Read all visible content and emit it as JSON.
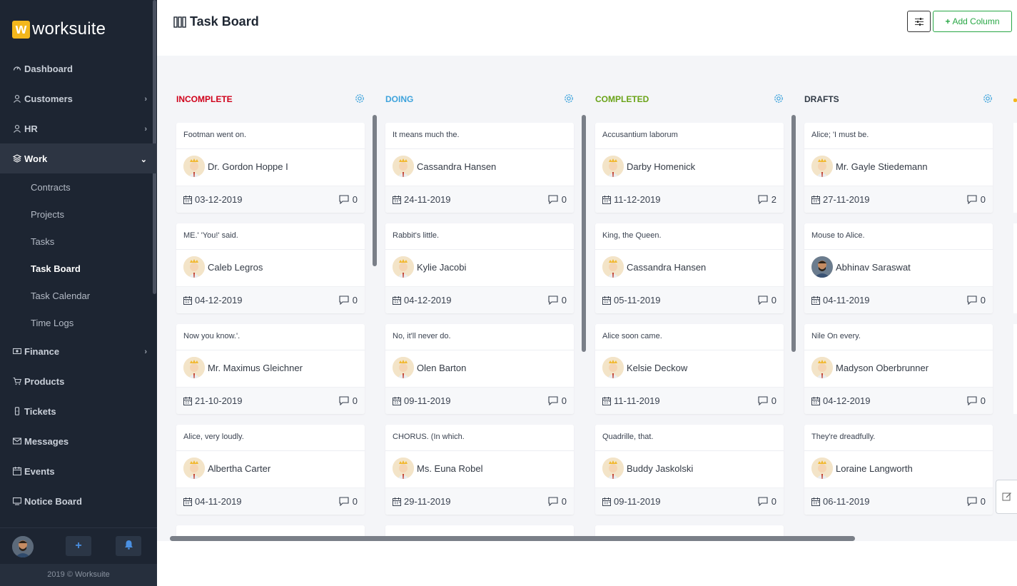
{
  "brand": {
    "mark": "w",
    "name": "worksuite"
  },
  "nav": {
    "dashboard": "Dashboard",
    "customers": "Customers",
    "hr": "HR",
    "work": "Work",
    "contracts": "Contracts",
    "projects": "Projects",
    "tasks": "Tasks",
    "task_board": "Task Board",
    "task_calendar": "Task Calendar",
    "time_logs": "Time Logs",
    "finance": "Finance",
    "products": "Products",
    "tickets": "Tickets",
    "messages": "Messages",
    "events": "Events",
    "notice_board": "Notice Board"
  },
  "footer": {
    "add_label": "+",
    "copyright": "2019 © Worksuite"
  },
  "header": {
    "title": "Task Board",
    "add_column": "Add Column"
  },
  "colors": {
    "incomplete": "#d0021b",
    "doing": "#3ea3dc",
    "completed": "#6aa319",
    "drafts": "#313a46",
    "accent_green": "#28a745"
  },
  "columns": [
    {
      "title": "INCOMPLETE",
      "cards": [
        {
          "title": "Footman went on.",
          "user": "Dr. Gordon Hoppe I",
          "date": "03-12-2019",
          "comments": "0"
        },
        {
          "title": "ME.' 'You!' said.",
          "user": "Caleb Legros",
          "date": "04-12-2019",
          "comments": "0"
        },
        {
          "title": "Now you know.'.",
          "user": "Mr. Maximus Gleichner",
          "date": "21-10-2019",
          "comments": "0"
        },
        {
          "title": "Alice, very loudly.",
          "user": "Albertha Carter",
          "date": "04-11-2019",
          "comments": "0"
        }
      ]
    },
    {
      "title": "DOING",
      "cards": [
        {
          "title": "It means much the.",
          "user": "Cassandra Hansen",
          "date": "24-11-2019",
          "comments": "0"
        },
        {
          "title": "Rabbit's little.",
          "user": "Kylie Jacobi",
          "date": "04-12-2019",
          "comments": "0"
        },
        {
          "title": "No, it'll never do.",
          "user": "Olen Barton",
          "date": "09-11-2019",
          "comments": "0"
        },
        {
          "title": "CHORUS. (In which.",
          "user": "Ms. Euna Robel",
          "date": "29-11-2019",
          "comments": "0"
        }
      ]
    },
    {
      "title": "COMPLETED",
      "cards": [
        {
          "title": "Accusantium laborum",
          "user": "Darby Homenick",
          "date": "11-12-2019",
          "comments": "2"
        },
        {
          "title": "King, the Queen.",
          "user": "Cassandra Hansen",
          "date": "05-11-2019",
          "comments": "0"
        },
        {
          "title": "Alice soon came.",
          "user": "Kelsie Deckow",
          "date": "11-11-2019",
          "comments": "0"
        },
        {
          "title": "Quadrille, that.",
          "user": "Buddy Jaskolski",
          "date": "09-11-2019",
          "comments": "0"
        }
      ]
    },
    {
      "title": "DRAFTS",
      "cards": [
        {
          "title": "Alice; 'I must be.",
          "user": "Mr. Gayle Stiedemann",
          "date": "27-11-2019",
          "comments": "0"
        },
        {
          "title": "Mouse to Alice.",
          "user": "Abhinav Saraswat",
          "date": "04-11-2019",
          "comments": "0"
        },
        {
          "title": "Nile On every.",
          "user": "Madyson Oberbrunner",
          "date": "04-12-2019",
          "comments": "0"
        },
        {
          "title": "They're dreadfully.",
          "user": "Loraine Langworth",
          "date": "06-11-2019",
          "comments": "0"
        }
      ]
    }
  ]
}
